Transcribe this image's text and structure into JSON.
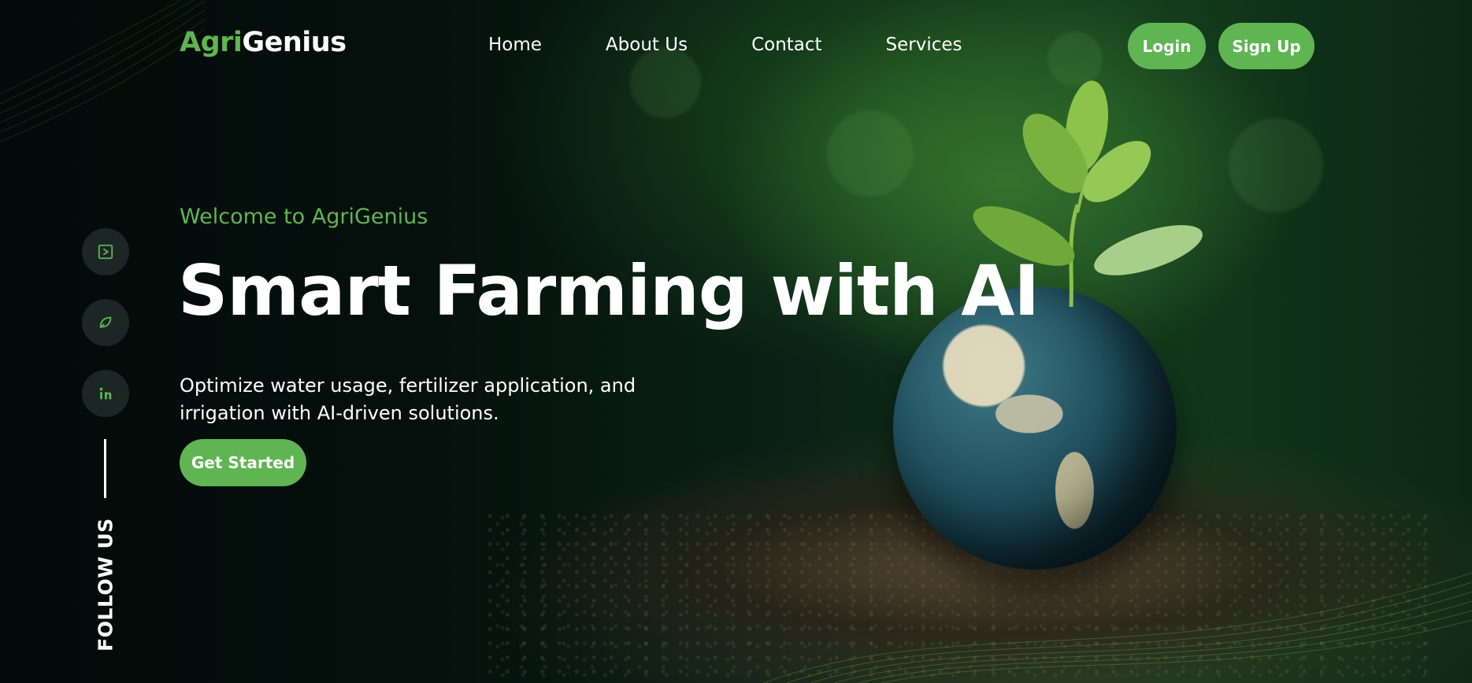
{
  "brand": {
    "prefix": "Agri",
    "suffix": "Genius",
    "accent_color": "#5fb552"
  },
  "nav": {
    "items": [
      {
        "label": "Home"
      },
      {
        "label": "About Us"
      },
      {
        "label": "Contact"
      },
      {
        "label": "Services"
      }
    ]
  },
  "auth": {
    "login_label": "Login",
    "signup_label": "Sign Up"
  },
  "hero": {
    "welcome": "Welcome to AgriGenius",
    "headline": "Smart Farming with AI",
    "subtext": "Optimize water usage, fertilizer application, and irrigation with AI-driven solutions.",
    "cta_label": "Get Started",
    "image_subject": "seedling growing from a globe on soil"
  },
  "social": {
    "follow_label": "FOLLOW US",
    "icons": [
      "play-square-icon",
      "leaf-chat-icon",
      "linkedin-icon"
    ]
  },
  "colors": {
    "accent": "#5fb552",
    "background": "#020807",
    "text": "#ffffff"
  }
}
